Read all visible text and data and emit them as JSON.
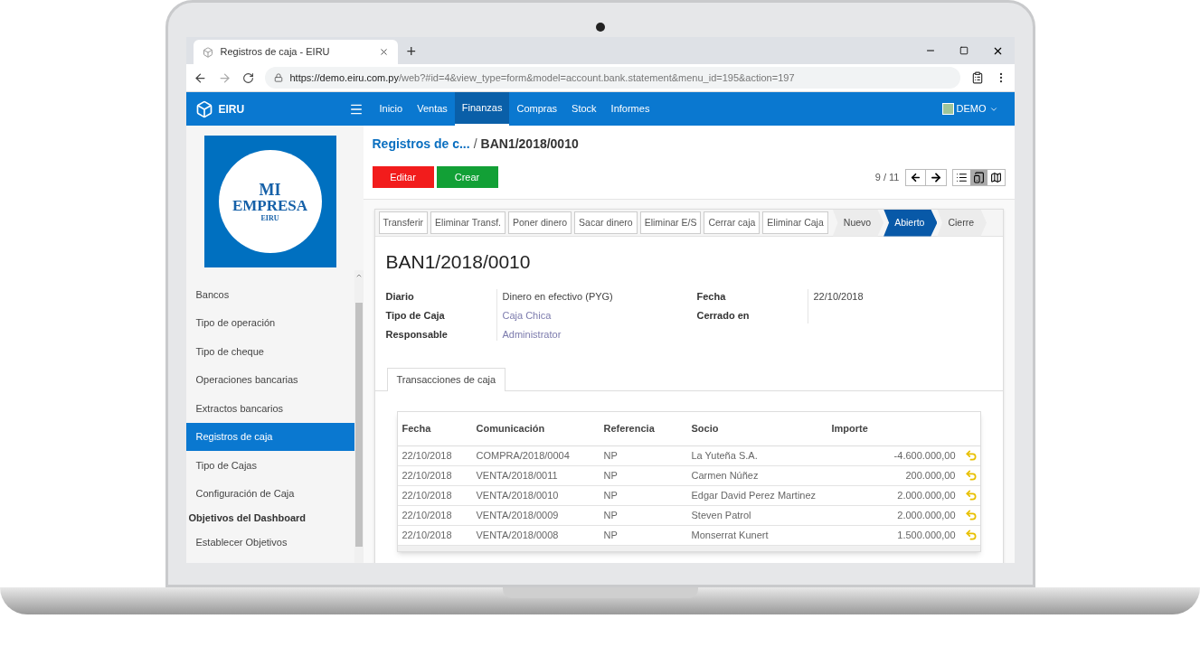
{
  "browser": {
    "tab_title": "Registros de caja - EIRU",
    "new_tab": "+",
    "url_host": "https://demo.eiru.com.py",
    "url_path": "/web?#id=4&view_type=form&model=account.bank.statement&menu_id=195&action=197"
  },
  "navbar": {
    "brand": "EIRU",
    "menus": [
      {
        "label": "Inicio",
        "selected": false
      },
      {
        "label": "Ventas",
        "selected": false
      },
      {
        "label": "Finanzas",
        "selected": true
      },
      {
        "label": "Compras",
        "selected": false
      },
      {
        "label": "Stock",
        "selected": false
      },
      {
        "label": "Informes",
        "selected": false
      }
    ],
    "user": "DEMO"
  },
  "sidebar": {
    "logo": {
      "line1": "MI",
      "line2": "EMPRESA",
      "sub": "EIRU"
    },
    "items": [
      {
        "kind": "item",
        "label": "Bancos",
        "selected": false
      },
      {
        "kind": "item",
        "label": "Tipo de operación",
        "selected": false
      },
      {
        "kind": "item",
        "label": "Tipo de cheque",
        "selected": false
      },
      {
        "kind": "item",
        "label": "Operaciones bancarias",
        "selected": false
      },
      {
        "kind": "item",
        "label": "Extractos bancarios",
        "selected": false
      },
      {
        "kind": "item",
        "label": "Registros de caja",
        "selected": true
      },
      {
        "kind": "item",
        "label": "Tipo de Cajas",
        "selected": false
      },
      {
        "kind": "item",
        "label": "Configuración de Caja",
        "selected": false
      },
      {
        "kind": "header",
        "label": "Objetivos del Dashboard"
      },
      {
        "kind": "item",
        "label": "Establecer Objetivos",
        "selected": false
      }
    ]
  },
  "breadcrumb": {
    "parent": "Registros de c...",
    "separator": "/",
    "current": "BAN1/2018/0010"
  },
  "actions": {
    "edit": "Editar",
    "create": "Crear"
  },
  "pager": "9 / 11",
  "form": {
    "buttons": [
      "Transferir",
      "Eliminar Transf.",
      "Poner dinero",
      "Sacar dinero",
      "Eliminar E/S",
      "Cerrar caja",
      "Eliminar Caja"
    ],
    "stages": [
      {
        "label": "Nuevo",
        "selected": false
      },
      {
        "label": "Abierto",
        "selected": true
      },
      {
        "label": "Cierre",
        "selected": false
      }
    ],
    "title": "BAN1/2018/0010",
    "left_fields": [
      {
        "label": "Diario",
        "value": "Dinero en efectivo (PYG)",
        "kind": "text"
      },
      {
        "label": "Tipo de Caja",
        "value": "Caja Chica",
        "kind": "link"
      },
      {
        "label": "Responsable",
        "value": "Administrator",
        "kind": "link"
      }
    ],
    "right_fields": [
      {
        "label": "Fecha",
        "value": "22/10/2018"
      },
      {
        "label": "Cerrado en"
      }
    ],
    "tabs": [
      {
        "label": "Transacciones de caja",
        "selected": true
      }
    ],
    "table": {
      "columns": [
        "Fecha",
        "Comunicación",
        "Referencia",
        "Socio",
        "Importe"
      ],
      "rows": [
        [
          "22/10/2018",
          "COMPRA/2018/0004",
          "NP",
          "La Yuteña S.A.",
          "-4.600.000,00"
        ],
        [
          "22/10/2018",
          "VENTA/2018/0011",
          "NP",
          "Carmen Núñez",
          "200.000,00"
        ],
        [
          "22/10/2018",
          "VENTA/2018/0010",
          "NP",
          "Edgar David Perez Martinez",
          "2.000.000,00"
        ],
        [
          "22/10/2018",
          "VENTA/2018/0009",
          "NP",
          "Steven Patrol",
          "2.000.000,00"
        ],
        [
          "22/10/2018",
          "VENTA/2018/0008",
          "NP",
          "Monserrat Kunert",
          "1.500.000,00"
        ]
      ]
    }
  }
}
